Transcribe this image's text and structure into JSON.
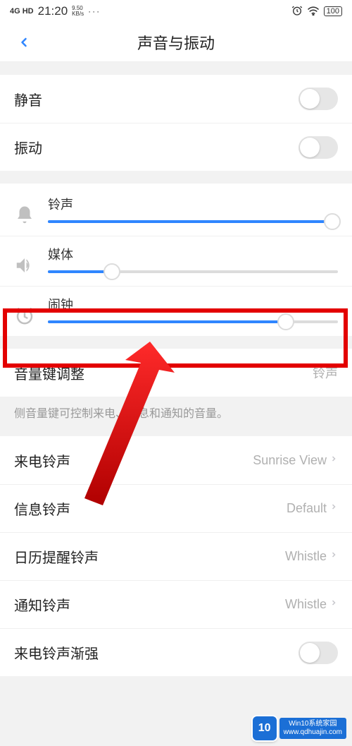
{
  "status_bar": {
    "signal": "4G HD",
    "time": "21:20",
    "speed_top": "9.50",
    "speed_bottom": "KB/s",
    "dots": "···",
    "battery": "100"
  },
  "header": {
    "title": "声音与振动"
  },
  "toggles": {
    "mute_label": "静音",
    "vibrate_label": "振动"
  },
  "sliders": {
    "ringtone": {
      "label": "铃声",
      "percent": 98
    },
    "media": {
      "label": "媒体",
      "percent": 22
    },
    "alarm": {
      "label": "闹钟",
      "percent": 82
    }
  },
  "volume_key": {
    "label": "音量键调整",
    "value": "铃声",
    "desc": "侧音量键可控制来电、信息和通知的音量。"
  },
  "rows": {
    "incoming": {
      "label": "来电铃声",
      "value": "Sunrise View"
    },
    "message": {
      "label": "信息铃声",
      "value": "Default"
    },
    "calendar": {
      "label": "日历提醒铃声",
      "value": "Whistle"
    },
    "notify": {
      "label": "通知铃声",
      "value": "Whistle"
    },
    "ascend": {
      "label": "来电铃声渐强"
    }
  },
  "watermark": {
    "badge": "10",
    "line1": "Win10系统家园",
    "line2": "www.qdhuajin.com"
  }
}
